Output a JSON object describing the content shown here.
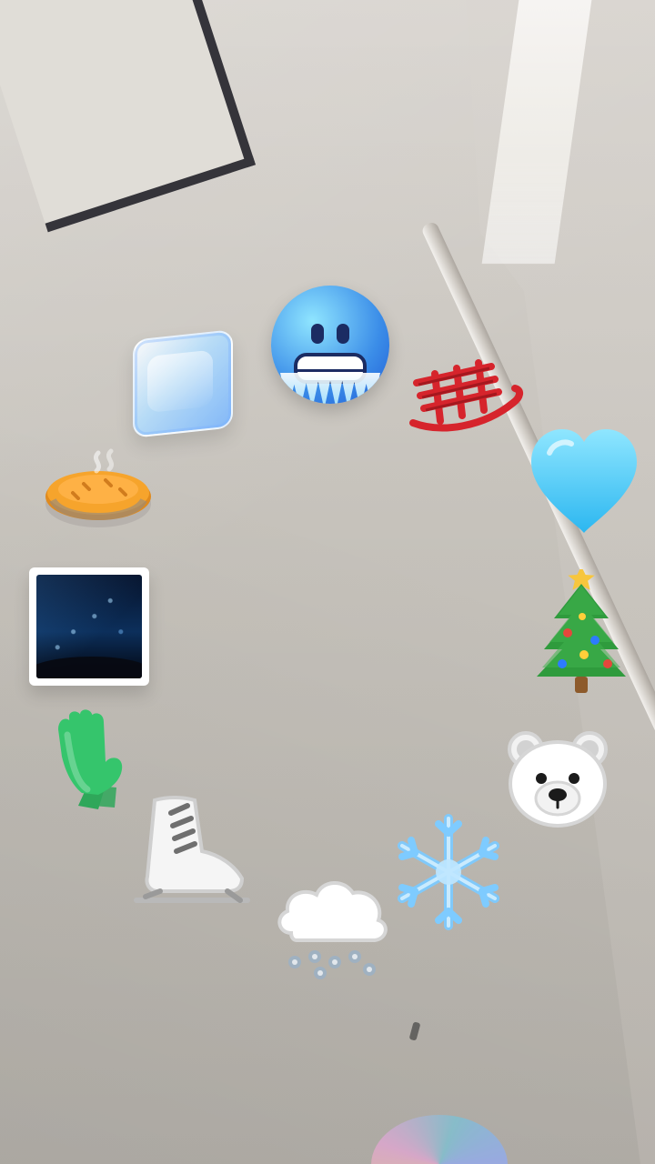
{
  "screen": {
    "background_description": "",
    "stickers": [
      {
        "id": "cold-face",
        "icon": "cold-face-icon"
      },
      {
        "id": "ice-cube",
        "icon": "ice-cube-icon"
      },
      {
        "id": "sled",
        "icon": "sled-icon"
      },
      {
        "id": "blue-heart",
        "icon": "blue-heart-icon"
      },
      {
        "id": "pie",
        "icon": "pie-icon"
      },
      {
        "id": "night-sky-photo",
        "icon": "night-sky-photo-icon"
      },
      {
        "id": "christmas-tree",
        "icon": "christmas-tree-icon"
      },
      {
        "id": "gloves",
        "icon": "gloves-icon"
      },
      {
        "id": "polar-bear",
        "icon": "polar-bear-icon"
      },
      {
        "id": "ice-skate",
        "icon": "ice-skate-icon"
      },
      {
        "id": "snowflake",
        "icon": "snowflake-icon"
      },
      {
        "id": "snow-cloud",
        "icon": "snow-cloud-icon"
      }
    ]
  }
}
